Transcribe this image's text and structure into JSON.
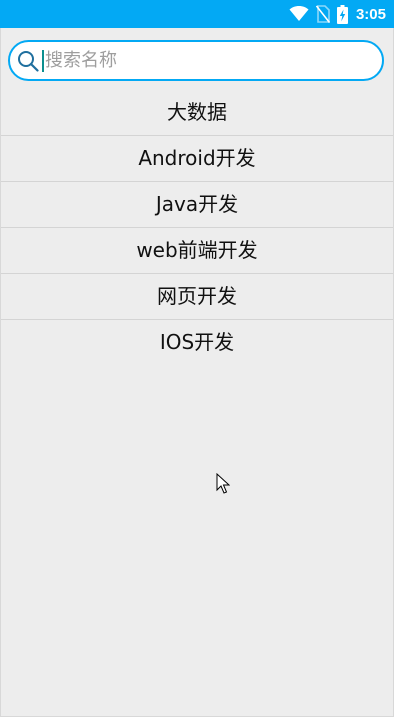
{
  "status_bar": {
    "time": "3:05",
    "icons": [
      "wifi-icon",
      "no-sim-icon",
      "battery-charging-icon"
    ],
    "background": "#03a9f4"
  },
  "search": {
    "placeholder": "搜索名称",
    "value": "",
    "accent_color": "#03a9f4",
    "icon": "search-icon"
  },
  "list": {
    "items": [
      {
        "label": "大数据"
      },
      {
        "label": "Android开发"
      },
      {
        "label": "Java开发"
      },
      {
        "label": "web前端开发"
      },
      {
        "label": "网页开发"
      },
      {
        "label": "IOS开发"
      }
    ]
  },
  "pointer": {
    "icon": "mouse-pointer-icon"
  }
}
